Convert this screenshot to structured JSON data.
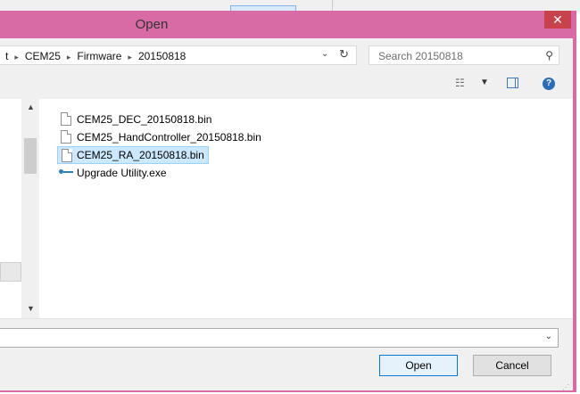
{
  "dialog": {
    "title": "Open",
    "close_glyph": "✕",
    "accent": "#d86ba6"
  },
  "address_bar": {
    "crumbs": [
      "t",
      "CEM25",
      "Firmware",
      "20150818"
    ],
    "separator": "▸",
    "dropdown_glyph": "⌄",
    "refresh_glyph": "↻"
  },
  "search": {
    "placeholder": "Search 20150818",
    "icon": "search-icon",
    "icon_glyph": "⚲"
  },
  "toolbar": {
    "view_glyph": "☷",
    "view_dropdown_glyph": "▼",
    "help_glyph": "?"
  },
  "files": [
    {
      "name": "CEM25_DEC_20150818.bin",
      "icon": "file-icon",
      "selected": false
    },
    {
      "name": "CEM25_HandController_20150818.bin",
      "icon": "file-icon",
      "selected": false
    },
    {
      "name": "CEM25_RA_20150818.bin",
      "icon": "file-icon",
      "selected": true
    },
    {
      "name": "Upgrade Utility.exe",
      "icon": "application-icon",
      "selected": false
    }
  ],
  "nav_scroll": {
    "up_glyph": "▲",
    "down_glyph": "▼"
  },
  "filename": {
    "value": "",
    "dropdown_glyph": "⌄"
  },
  "buttons": {
    "open": "Open",
    "cancel": "Cancel"
  },
  "grip_glyph": "⋰"
}
